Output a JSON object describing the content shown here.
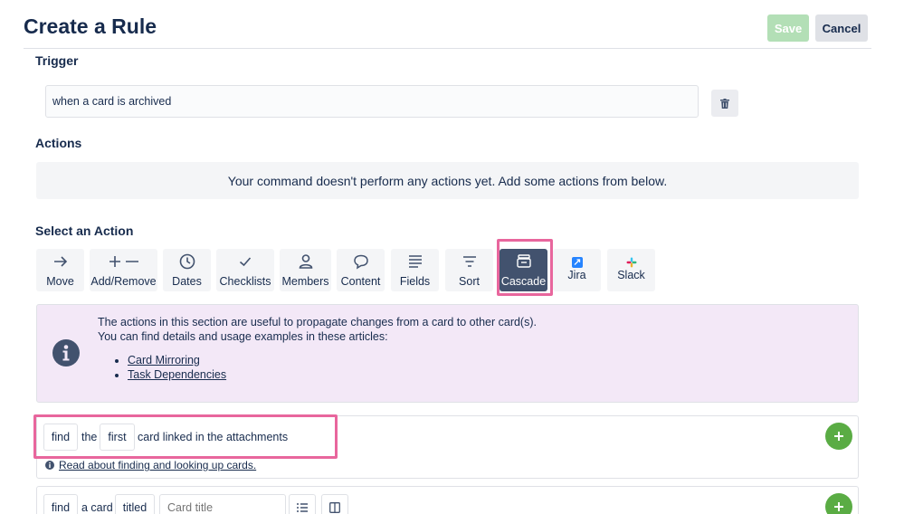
{
  "header": {
    "title": "Create a Rule",
    "save_label": "Save",
    "cancel_label": "Cancel"
  },
  "trigger": {
    "section_label": "Trigger",
    "value": "when a card is archived"
  },
  "actions": {
    "section_label": "Actions",
    "empty_message": "Your command doesn't perform any actions yet. Add some actions from below."
  },
  "select_action": {
    "section_label": "Select an Action",
    "tabs": [
      {
        "label": "Move",
        "icon": "arrow-right-icon"
      },
      {
        "label": "Add/Remove",
        "icon": "plus-minus-icon"
      },
      {
        "label": "Dates",
        "icon": "clock-icon"
      },
      {
        "label": "Checklists",
        "icon": "checkmark-icon"
      },
      {
        "label": "Members",
        "icon": "person-icon"
      },
      {
        "label": "Content",
        "icon": "comment-icon"
      },
      {
        "label": "Fields",
        "icon": "lines-icon"
      },
      {
        "label": "Sort",
        "icon": "sort-icon"
      },
      {
        "label": "Cascade",
        "icon": "cascade-icon",
        "selected": true
      },
      {
        "label": "Jira",
        "icon": "jira-icon"
      },
      {
        "label": "Slack",
        "icon": "slack-icon"
      }
    ]
  },
  "info": {
    "line1": "The actions in this section are useful to propagate changes from a card to other card(s).",
    "line2": "You can find details and usage examples in these articles:",
    "links": [
      "Card Mirroring",
      "Task Dependencies"
    ]
  },
  "rule1": {
    "find": "find",
    "the": "the",
    "first": "first",
    "rest": "card linked in the attachments",
    "read_link": "Read about finding and looking up cards."
  },
  "rule2": {
    "find": "find",
    "a_card": "a card",
    "titled": "titled",
    "placeholder": "Card title"
  },
  "colors": {
    "accent_green": "#5aac44",
    "highlight_pink": "#e8669d",
    "selected_tab": "#42526e",
    "info_bg": "#f3e8f7"
  }
}
